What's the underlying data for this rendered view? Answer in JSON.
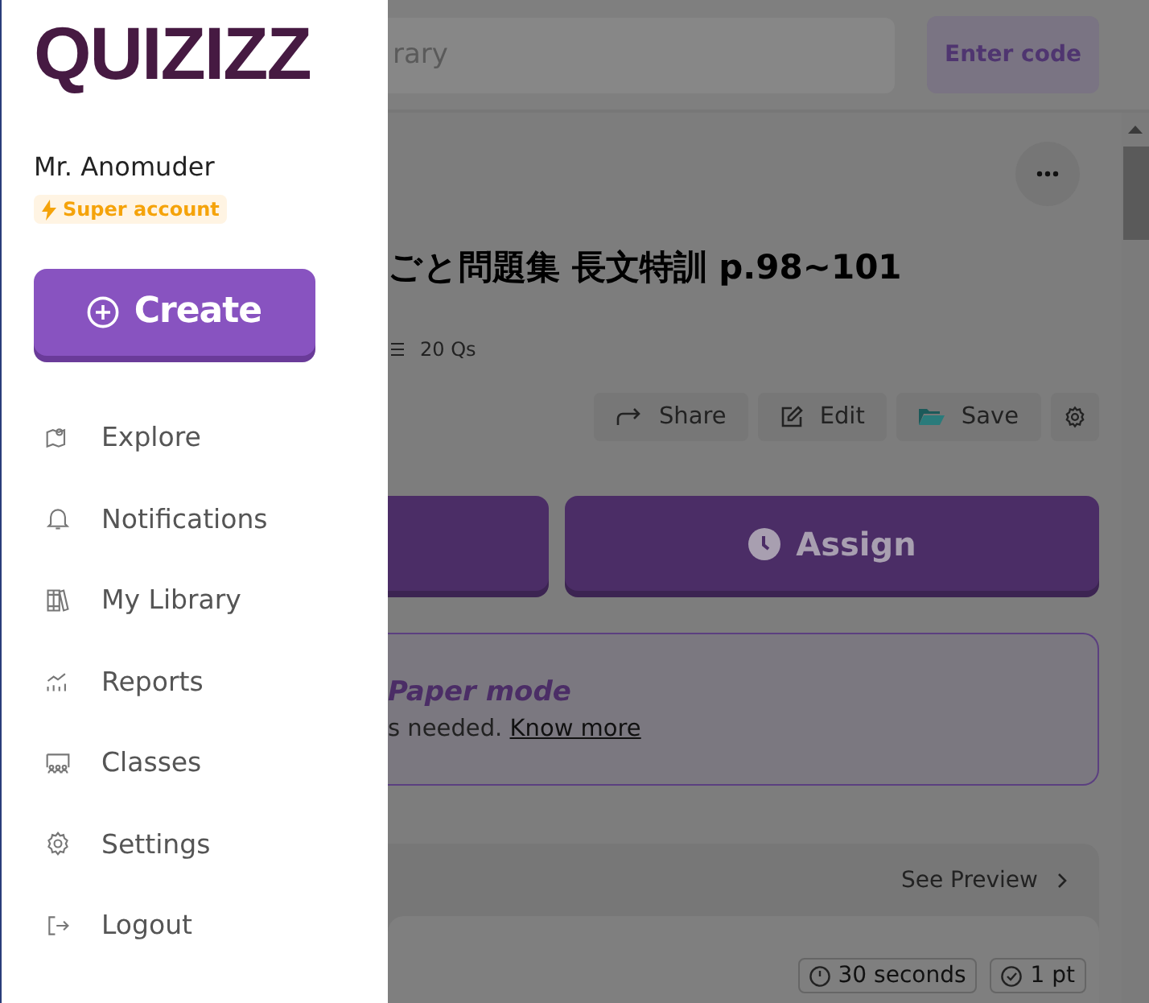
{
  "sidebar": {
    "logo": "QUIZIZZ",
    "user_name": "Mr. Anomuder",
    "badge": "Super account",
    "create_button": "Create",
    "items": [
      {
        "label": "Explore",
        "kind": "map"
      },
      {
        "label": "Notifications",
        "kind": "bell"
      },
      {
        "label": "My Library",
        "kind": "books"
      },
      {
        "label": "Reports",
        "kind": "chart"
      },
      {
        "label": "Classes",
        "kind": "class"
      },
      {
        "label": "Settings",
        "kind": "gear"
      },
      {
        "label": "Logout",
        "kind": "logout"
      }
    ]
  },
  "header": {
    "search_placeholder": "rary",
    "enter_code_button": "Enter code"
  },
  "quiz": {
    "title": "ごと問題集 長文特訓 p.98~101",
    "question_count": "20 Qs",
    "actions": [
      {
        "label": "Share",
        "kind": "share"
      },
      {
        "label": "Edit",
        "kind": "edit"
      },
      {
        "label": "Save",
        "kind": "folder"
      }
    ],
    "assign_button": "Assign"
  },
  "banner": {
    "heading": "Paper mode",
    "text": "s needed.",
    "link": "Know more"
  },
  "preview": {
    "link": "See Preview",
    "chips": [
      {
        "label": "30 seconds",
        "kind": "clock"
      },
      {
        "label": "1 pt",
        "kind": "check"
      }
    ]
  }
}
